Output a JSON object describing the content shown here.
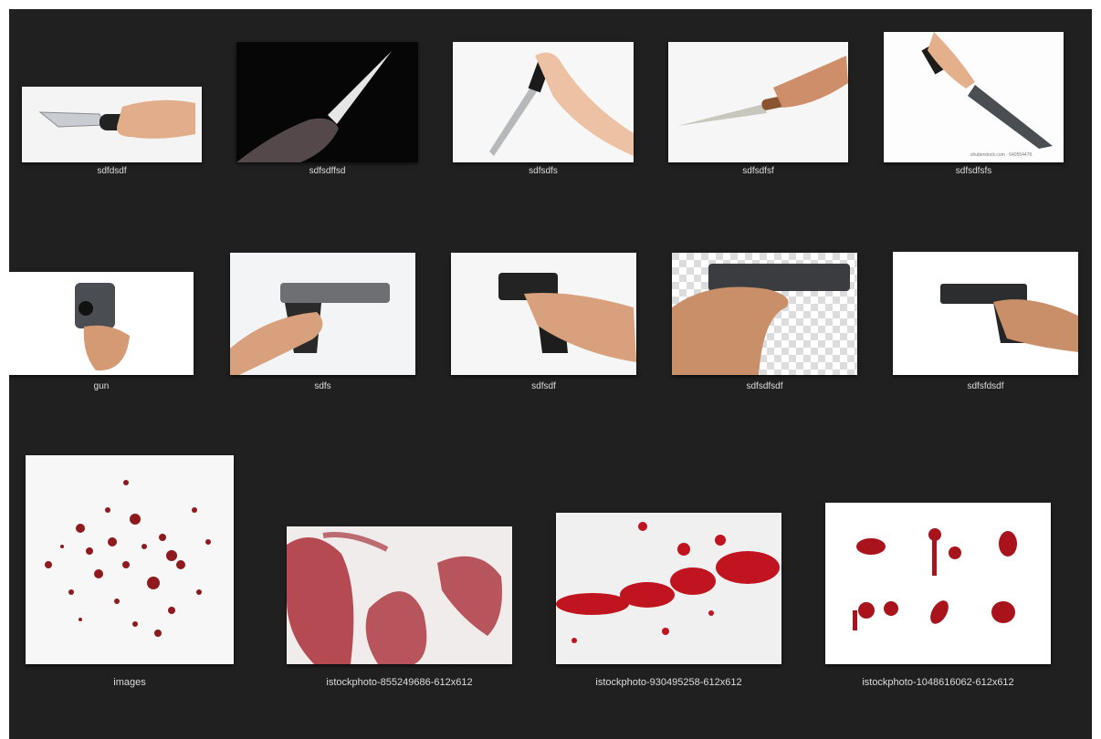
{
  "colors": {
    "background": "#202020",
    "label": "#dcdcdc",
    "blood": "#a3121c",
    "metal": "#2b2b2b",
    "skin": "#d9a07a"
  },
  "rows": [
    {
      "kind": "knives",
      "items": [
        {
          "name": "sdfdsdf",
          "icon": "knife-thumbnail"
        },
        {
          "name": "sdfsdffsd",
          "icon": "knife-thumbnail"
        },
        {
          "name": "sdfsdfs",
          "icon": "knife-thumbnail"
        },
        {
          "name": "sdfsdfsf",
          "icon": "knife-thumbnail"
        },
        {
          "name": "sdfsdfsfs",
          "icon": "knife-thumbnail",
          "watermark": "shutterstock.com · 640554476"
        }
      ]
    },
    {
      "kind": "guns",
      "items": [
        {
          "name": "gun",
          "icon": "pistol-thumbnail"
        },
        {
          "name": "sdfs",
          "icon": "pistol-thumbnail"
        },
        {
          "name": "sdfsdf",
          "icon": "pistol-thumbnail"
        },
        {
          "name": "sdfsdfsdf",
          "icon": "pistol-thumbnail"
        },
        {
          "name": "sdfsfdsdf",
          "icon": "pistol-thumbnail"
        }
      ]
    },
    {
      "kind": "blood",
      "items": [
        {
          "name": "images",
          "icon": "blood-splatter-thumbnail"
        },
        {
          "name": "istockphoto-855249686-612x612",
          "icon": "blood-smear-thumbnail"
        },
        {
          "name": "istockphoto-930495258-612x612",
          "icon": "blood-splatter-thumbnail"
        },
        {
          "name": "istockphoto-1048616062-612x612",
          "icon": "blood-drops-thumbnail"
        }
      ]
    }
  ]
}
